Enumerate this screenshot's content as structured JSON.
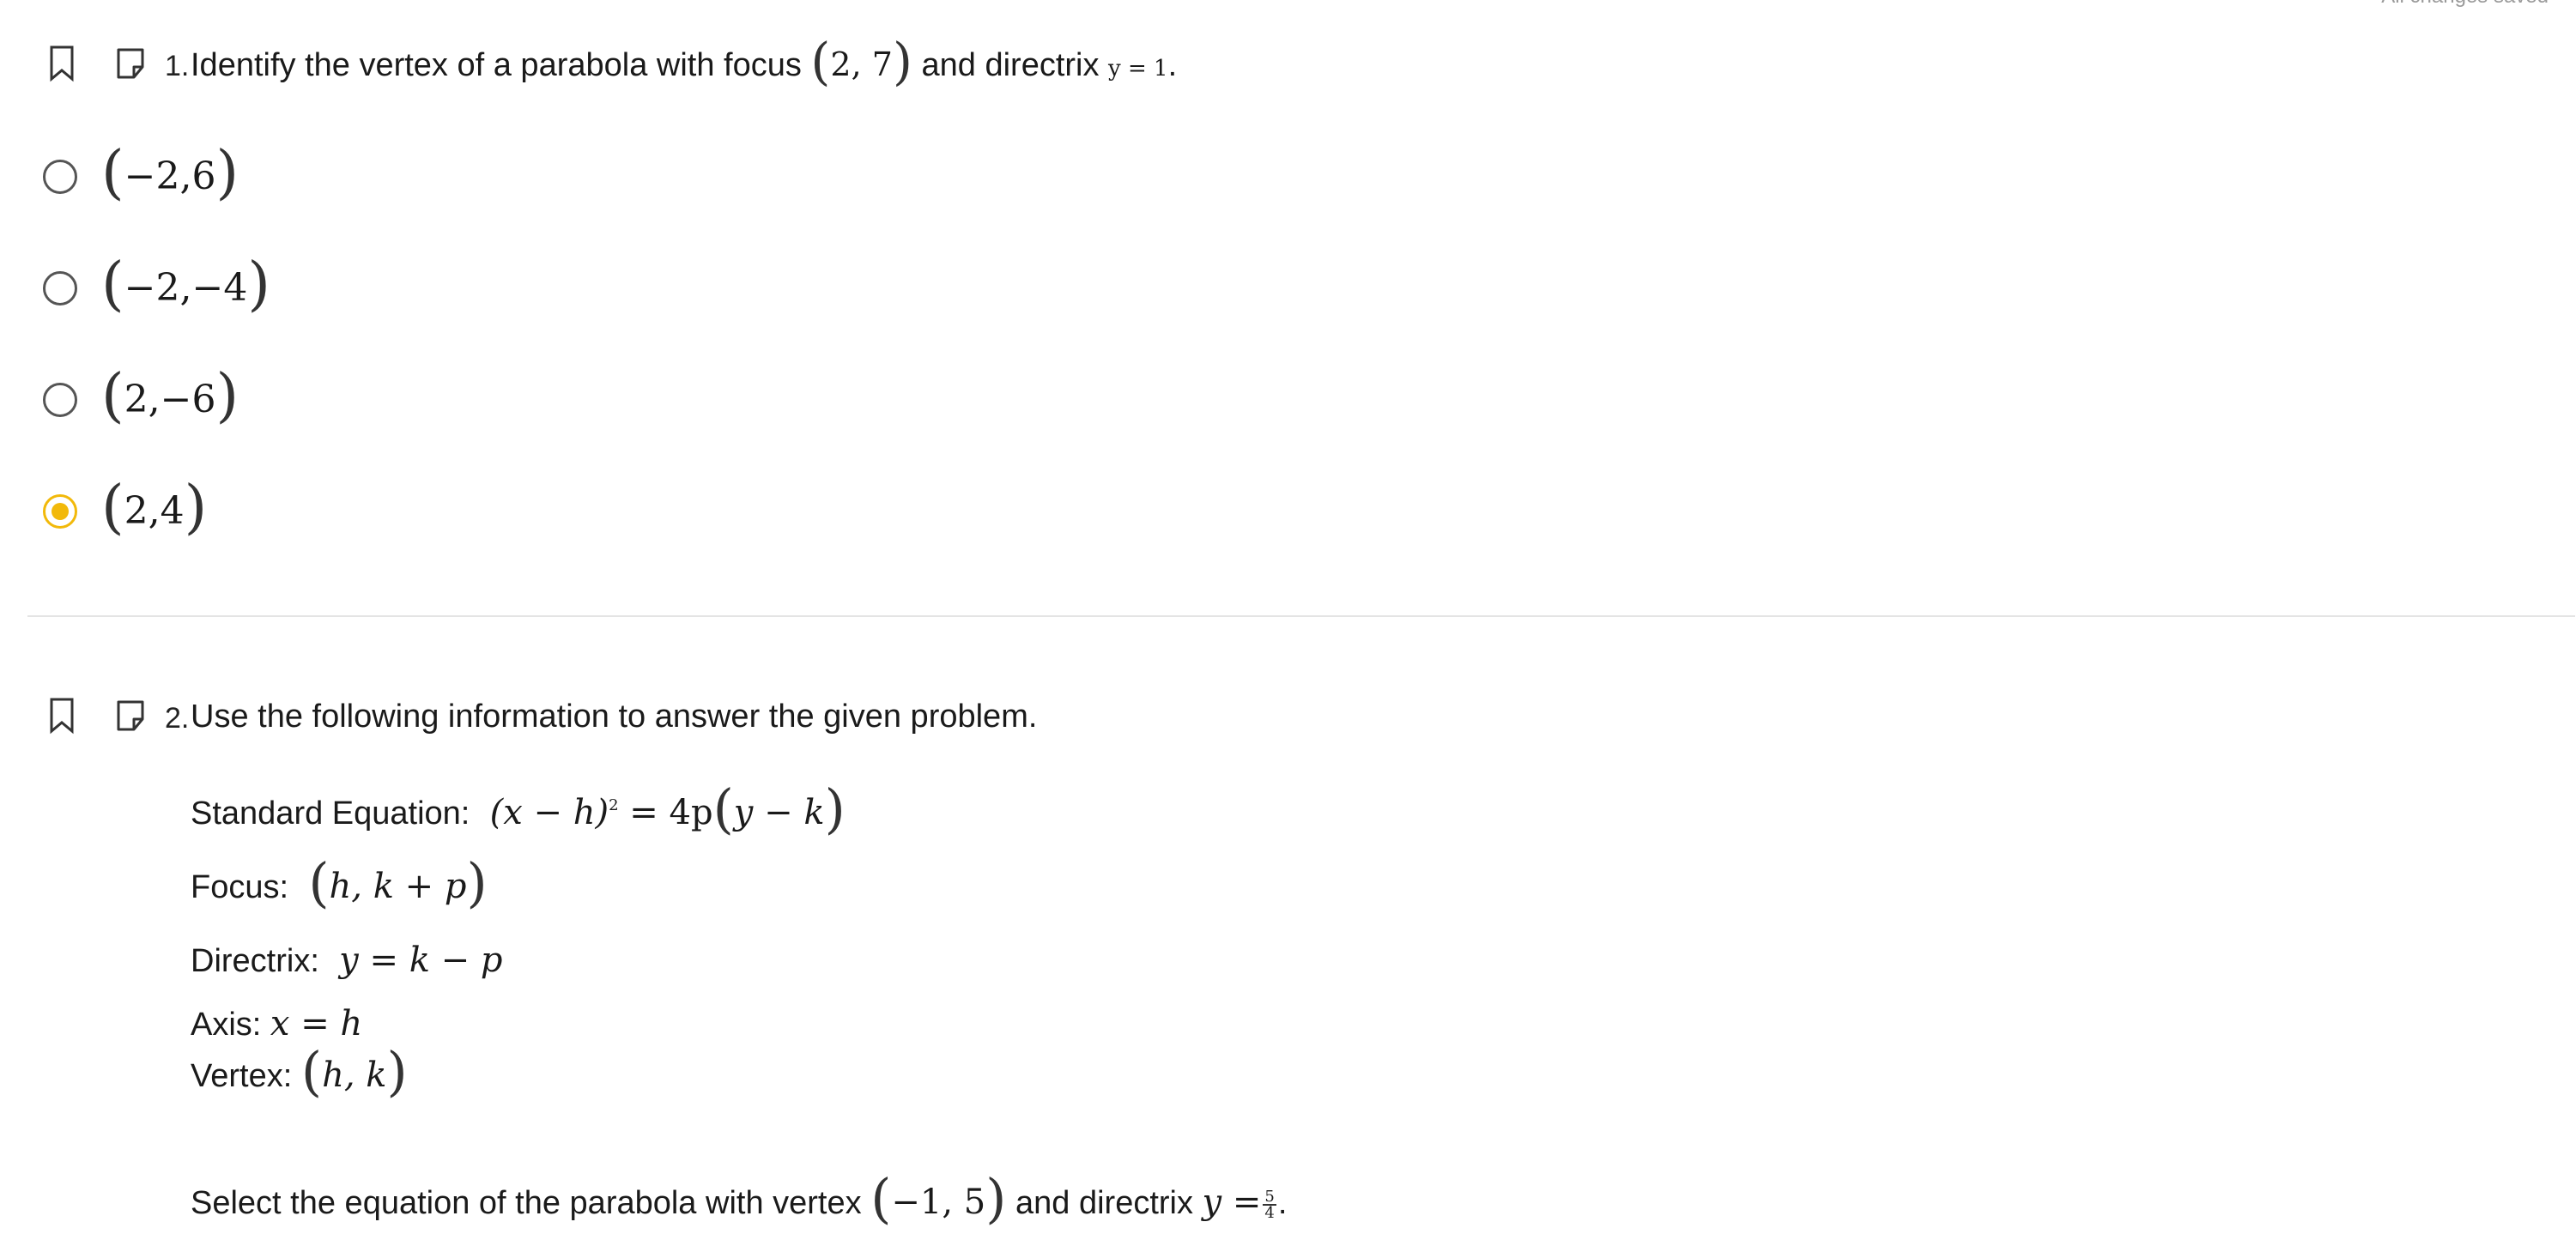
{
  "header": {
    "save_status": "All changes saved"
  },
  "questions": [
    {
      "number": "1.",
      "text_before": "Identify the vertex of a parabola with focus",
      "focus": {
        "x": "2",
        "y": "7"
      },
      "text_middle": "and directrix",
      "directrix": "y = 1",
      "text_after": ".",
      "choices": [
        {
          "x": "−2",
          "y": "6",
          "selected": false
        },
        {
          "x": "−2",
          "y": "−4",
          "selected": false
        },
        {
          "x": "2",
          "y": "−6",
          "selected": false
        },
        {
          "x": "2",
          "y": "4",
          "selected": true
        }
      ]
    },
    {
      "number": "2.",
      "text": "Use the following information to answer the given problem.",
      "info": {
        "standard_label": "Standard Equation:",
        "standard_lhs": "(x − h)",
        "standard_exp": "2",
        "standard_rhs_coef": "= 4p",
        "standard_rhs_inner": "y − k",
        "focus_label": "Focus:",
        "focus_value": "h, k + p",
        "directrix_label": "Directrix:",
        "directrix_value": "y = k − p",
        "axis_label": "Axis:",
        "axis_value": "x = h",
        "vertex_label": "Vertex:",
        "vertex_value": "h, k"
      },
      "prompt_before": "Select the equation of the parabola with vertex",
      "prompt_vertex": "−1, 5",
      "prompt_middle": "and directrix",
      "prompt_directrix_lhs": "y =",
      "prompt_frac_num": "5",
      "prompt_frac_den": "4",
      "prompt_after": "."
    }
  ]
}
